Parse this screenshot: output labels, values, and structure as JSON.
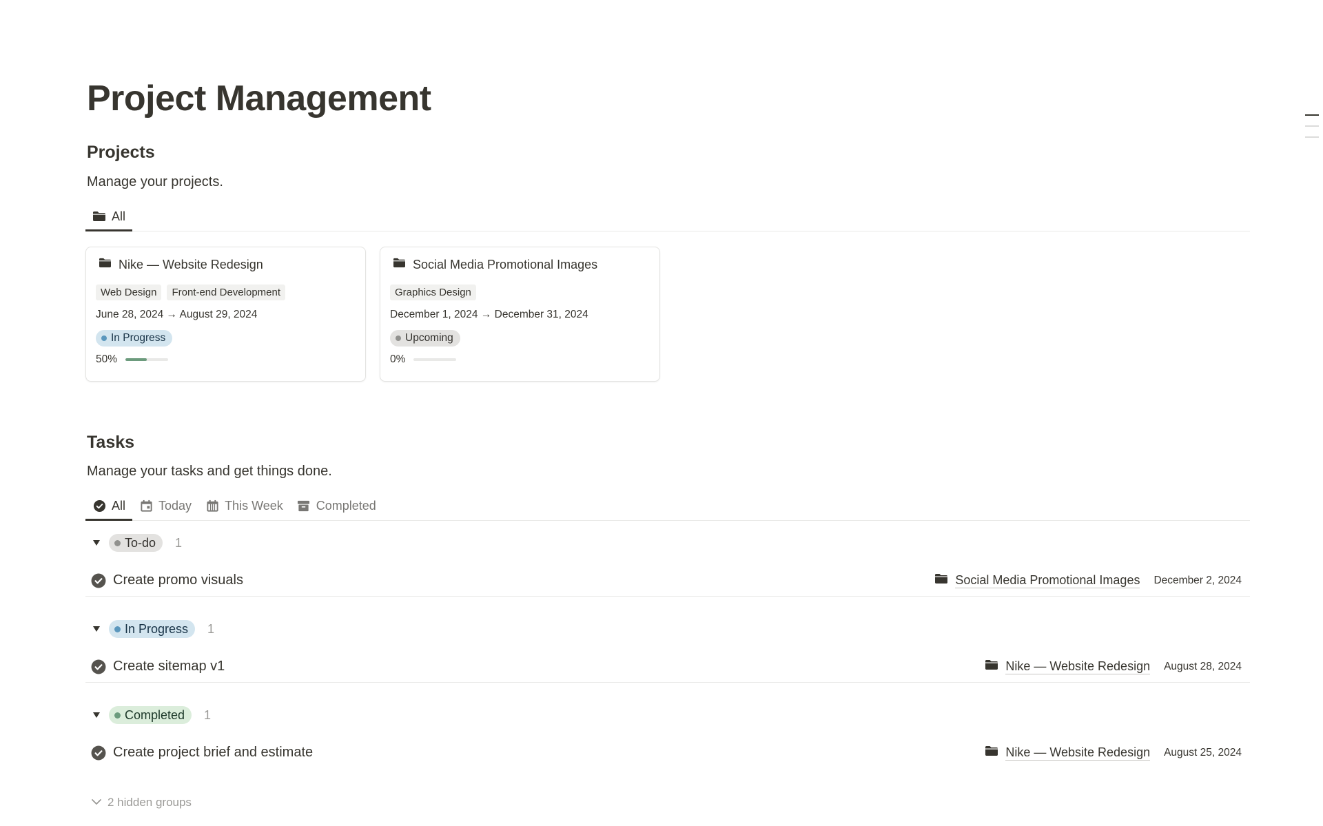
{
  "page": {
    "title": "Project Management"
  },
  "projects": {
    "title": "Projects",
    "description": "Manage your projects.",
    "views": [
      {
        "label": "All",
        "icon": "folder-icon",
        "active": true
      }
    ],
    "cards": [
      {
        "title": "Nike — Website Redesign",
        "icon": "folder-icon",
        "tags": [
          "Web Design",
          "Front-end Development"
        ],
        "dates": "June 28, 2024 → August 29, 2024",
        "status": "In Progress",
        "progress_label": "50%",
        "progress": 0.5
      },
      {
        "title": "Social Media Promotional Images",
        "icon": "folder-icon",
        "tags": [
          "Graphics Design"
        ],
        "dates": "December 1, 2024 → December 31, 2024",
        "status": "Upcoming",
        "progress_label": "0%",
        "progress": 0
      }
    ]
  },
  "tasks": {
    "title": "Tasks",
    "description": "Manage your tasks and get things done.",
    "views": [
      {
        "label": "All",
        "icon": "check-circle-icon",
        "active": true
      },
      {
        "label": "Today",
        "icon": "calendar-icon",
        "active": false
      },
      {
        "label": "This Week",
        "icon": "calendar-week-icon",
        "active": false
      },
      {
        "label": "Completed",
        "icon": "archive-icon",
        "active": false
      }
    ],
    "groups": [
      {
        "label": "To-do",
        "count": "1",
        "tasks": [
          {
            "name": "Create promo visuals",
            "project": "Social Media Promotional Images",
            "date": "December 2, 2024"
          }
        ]
      },
      {
        "label": "In Progress",
        "count": "1",
        "tasks": [
          {
            "name": "Create sitemap v1",
            "project": "Nike — Website Redesign",
            "date": "August 28, 2024"
          }
        ]
      },
      {
        "label": "Completed",
        "count": "1",
        "tasks": [
          {
            "name": "Create project brief and estimate",
            "project": "Nike — Website Redesign",
            "date": "August 25, 2024"
          }
        ]
      }
    ],
    "hidden_groups_label": "2 hidden groups"
  },
  "colors": {
    "text": "#37352f",
    "muted": "#787774",
    "in_progress_bg": "#d3e5ef",
    "upcoming_bg": "#e3e2e0",
    "completed_bg": "#dbeddb",
    "progress_fill": "#6c9b7d"
  }
}
